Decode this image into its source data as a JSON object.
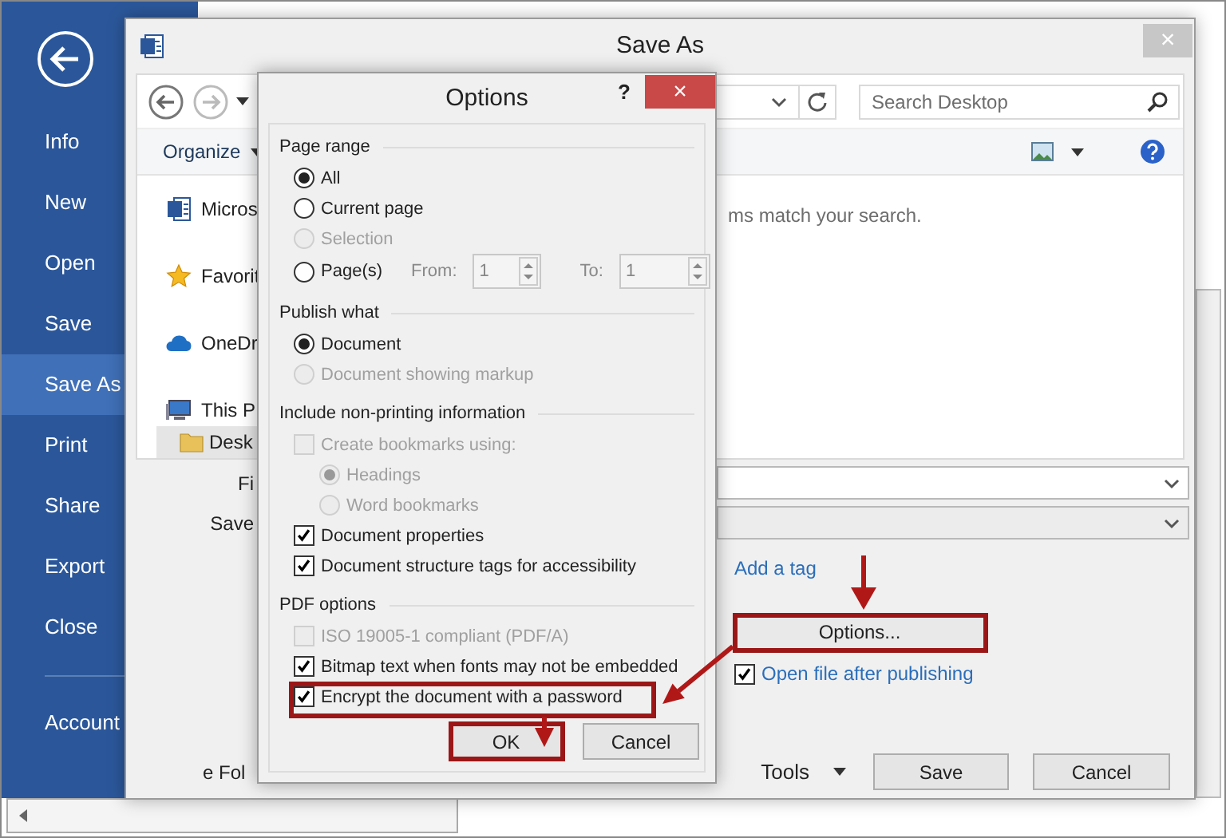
{
  "backstage": {
    "items": [
      {
        "label": "Info",
        "selected": false
      },
      {
        "label": "New",
        "selected": false
      },
      {
        "label": "Open",
        "selected": false
      },
      {
        "label": "Save",
        "selected": false
      },
      {
        "label": "Save As",
        "selected": true
      },
      {
        "label": "Print",
        "selected": false
      },
      {
        "label": "Share",
        "selected": false
      },
      {
        "label": "Export",
        "selected": false
      },
      {
        "label": "Close",
        "selected": false
      }
    ],
    "footer_items": [
      {
        "label": "Account",
        "selected": false
      }
    ]
  },
  "save_as": {
    "title": "Save As",
    "close": "×",
    "search": {
      "placeholder": "Search Desktop"
    },
    "organize": "Organize",
    "nav": [
      {
        "label": "Micros",
        "kind": "word",
        "selected": false
      },
      {
        "label": "Favorit",
        "kind": "star",
        "selected": false
      },
      {
        "label": "OneDr",
        "kind": "cloud",
        "selected": false
      },
      {
        "label": "This P",
        "kind": "computer",
        "selected": false,
        "children": [
          {
            "label": "Desk",
            "kind": "folder",
            "selected": true
          }
        ]
      }
    ],
    "message": "ms match your search.",
    "fields": [
      {
        "label": "Fi",
        "kind": "text"
      },
      {
        "label": "Save",
        "kind": "dropdown"
      }
    ],
    "tag_link": "Add a tag",
    "options_button": "Options...",
    "open_after": {
      "label": "Open file after publishing",
      "checked": true
    },
    "folders": "e Fol",
    "tools": "Tools",
    "buttons": [
      "Save",
      "Cancel"
    ]
  },
  "options": {
    "title": "Options",
    "help": "?",
    "close": "×",
    "groups": [
      {
        "title": "Page range",
        "items": [
          {
            "kind": "radio",
            "label": "All",
            "checked": true,
            "disabled": false
          },
          {
            "kind": "radio",
            "label": "Current page",
            "checked": false,
            "disabled": false
          },
          {
            "kind": "radio",
            "label": "Selection",
            "checked": false,
            "disabled": true
          },
          {
            "kind": "range",
            "label": "Page(s)",
            "checked": false,
            "disabled": false,
            "from_label": "From:",
            "from_value": "1",
            "to_label": "To:",
            "to_value": "1"
          }
        ]
      },
      {
        "title": "Publish what",
        "items": [
          {
            "kind": "radio",
            "label": "Document",
            "checked": true,
            "disabled": false
          },
          {
            "kind": "radio",
            "label": "Document showing markup",
            "checked": false,
            "disabled": true
          }
        ]
      },
      {
        "title": "Include non-printing information",
        "items": [
          {
            "kind": "checkbox",
            "label": "Create bookmarks using:",
            "checked": false,
            "disabled": true,
            "children": [
              {
                "kind": "radio",
                "label": "Headings",
                "checked": true,
                "disabled": true
              },
              {
                "kind": "radio",
                "label": "Word bookmarks",
                "checked": false,
                "disabled": true
              }
            ]
          },
          {
            "kind": "checkbox",
            "label": "Document properties",
            "checked": true,
            "disabled": false
          },
          {
            "kind": "checkbox",
            "label": "Document structure tags for accessibility",
            "checked": true,
            "disabled": false
          }
        ]
      },
      {
        "title": "PDF options",
        "items": [
          {
            "kind": "checkbox",
            "label": "ISO 19005-1 compliant (PDF/A)",
            "checked": false,
            "disabled": true
          },
          {
            "kind": "checkbox",
            "label": "Bitmap text when fonts may not be embedded",
            "checked": true,
            "disabled": false
          },
          {
            "kind": "checkbox",
            "label": "Encrypt the document with a password",
            "checked": true,
            "disabled": false
          }
        ]
      }
    ],
    "buttons": [
      "OK",
      "Cancel"
    ]
  }
}
